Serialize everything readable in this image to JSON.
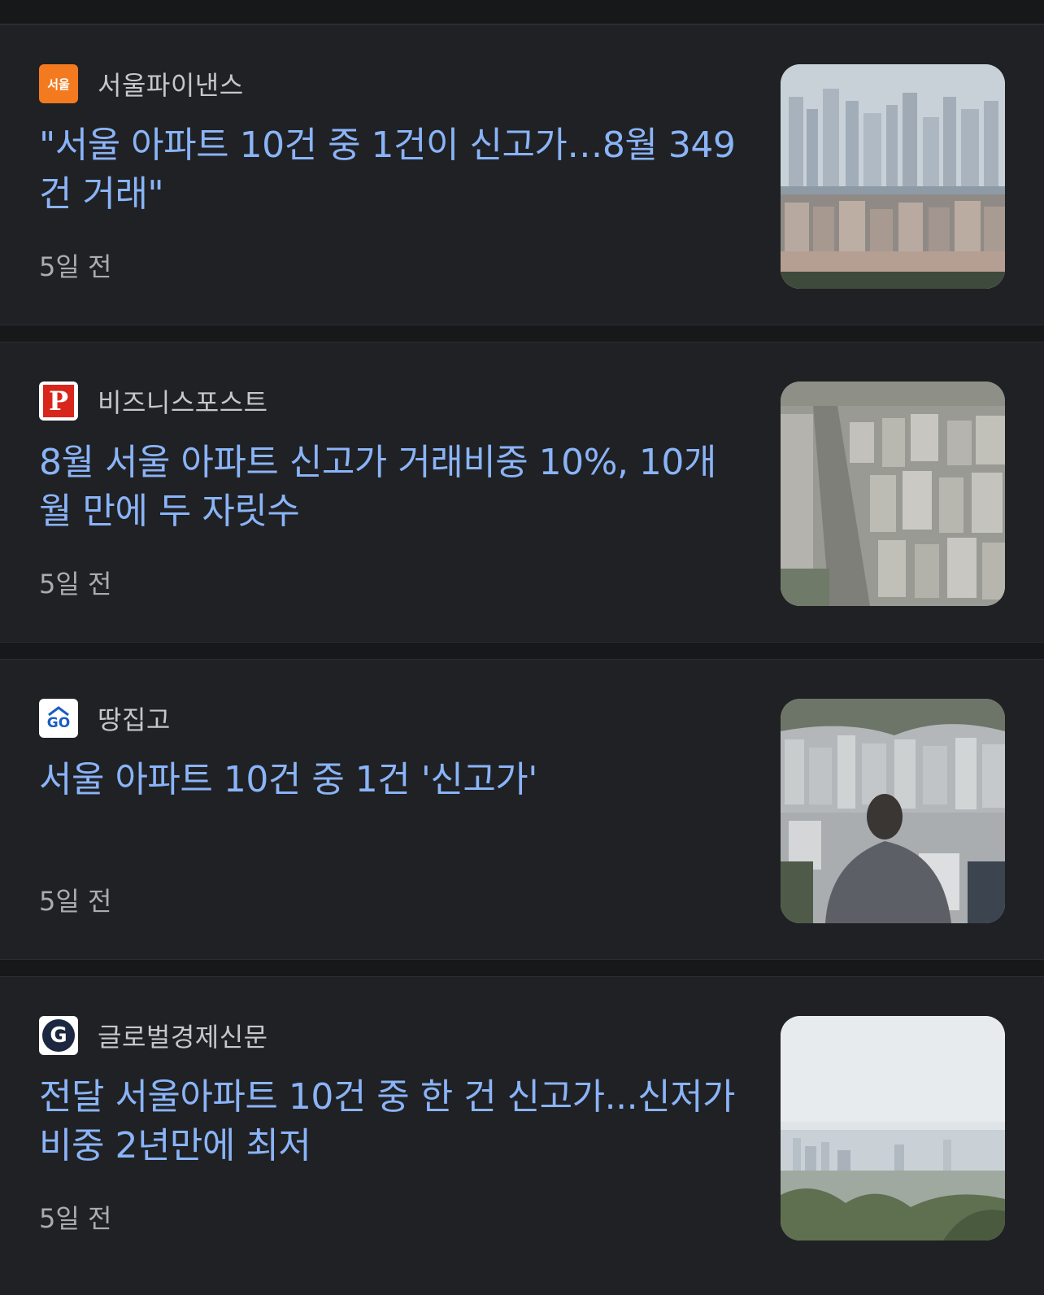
{
  "articles": [
    {
      "source": "서울파이낸스",
      "logo_text": "서울",
      "logo_color": "#f47a20",
      "headline": "\"서울 아파트 10건 중 1건이 신고가…8월 349건 거래\"",
      "time": "5일 전",
      "thumbnail": "city-skyline-photo"
    },
    {
      "source": "비즈니스포스트",
      "logo_text": "P",
      "logo_color": "#d9261c",
      "headline": "8월 서울 아파트 신고가 거래비중 10%, 10개월 만에 두 자릿수",
      "time": "5일 전",
      "thumbnail": "aerial-apartments-photo"
    },
    {
      "source": "땅집고",
      "logo_text": "GO",
      "logo_color": "#1a5dc2",
      "headline": "서울 아파트 10건 중 1건 '신고가'",
      "time": "5일 전",
      "thumbnail": "person-overlooking-city-photo"
    },
    {
      "source": "글로벌경제신문",
      "logo_text": "G",
      "logo_color": "#1c2741",
      "headline": "전달 서울아파트 10건 중 한 건 신고가...신저가 비중 2년만에 최저",
      "time": "5일 전",
      "thumbnail": "hazy-city-view-photo"
    }
  ]
}
